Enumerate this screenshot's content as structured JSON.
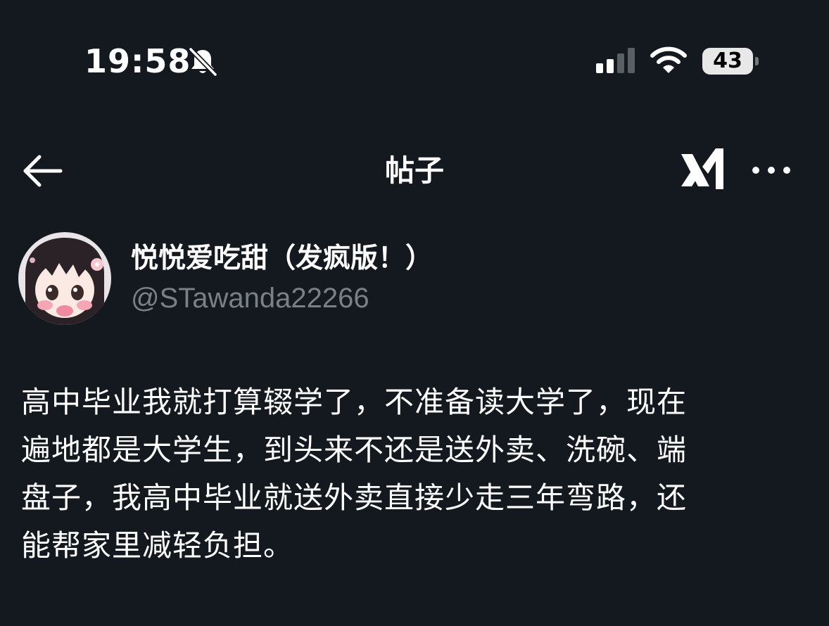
{
  "status_bar": {
    "time": "19:58",
    "battery_level": "43",
    "icons": [
      "bell-off-icon",
      "cellular-signal-icon",
      "wifi-icon",
      "battery-icon"
    ]
  },
  "nav": {
    "title": "帖子",
    "icons": [
      "back-arrow-icon",
      "grok-icon",
      "more-icon"
    ]
  },
  "post": {
    "author": {
      "display_name": "悦悦爱吃甜（发疯版！）",
      "handle": "@STawanda22266"
    },
    "body_lines": [
      "高中毕业我就打算辍学了，不准备读大学了，现在",
      "遍地都是大学生，到头来不还是送外卖、洗碗、端",
      "盘子，我高中毕业就送外卖直接少走三年弯路，还",
      "能帮家里减轻负担。"
    ]
  },
  "colors": {
    "background": "#141920",
    "text": "#ffffff",
    "secondary_text": "#7a8088"
  }
}
